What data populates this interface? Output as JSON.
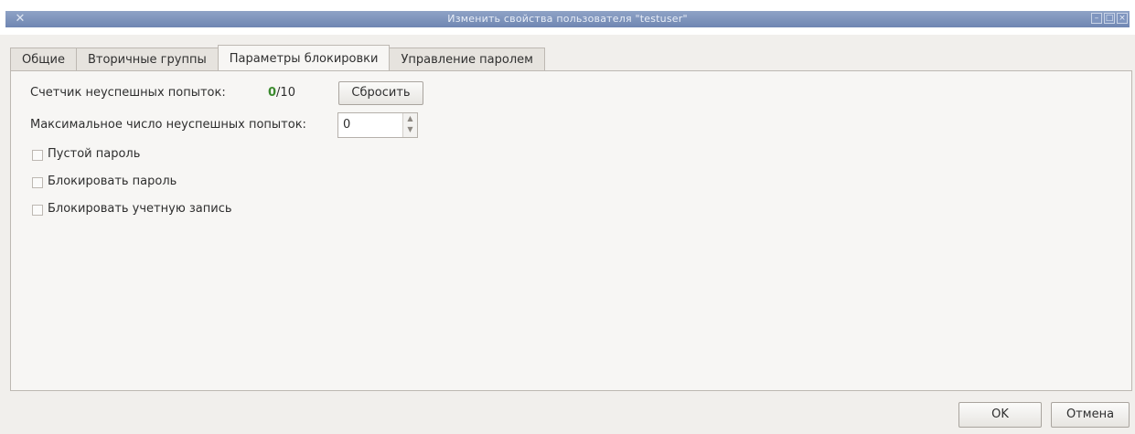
{
  "window": {
    "title": "Изменить свойства пользователя \"testuser\"",
    "app_icon": "app-icon",
    "controls": [
      "minimize-icon",
      "maximize-icon",
      "close-icon"
    ]
  },
  "tabs": [
    {
      "label": "Общие",
      "active": false
    },
    {
      "label": "Вторичные группы",
      "active": false
    },
    {
      "label": "Параметры блокировки",
      "active": true
    },
    {
      "label": "Управление паролем",
      "active": false
    }
  ],
  "lock": {
    "failed_label": "Счетчик неуспешных попыток:",
    "failed_count": "0",
    "failed_total": "/10",
    "reset_label": "Сбросить",
    "max_label": "Максимальное число неуспешных попыток:",
    "max_value": "0",
    "checkboxes": [
      {
        "label": "Пустой пароль",
        "checked": false
      },
      {
        "label": "Блокировать пароль",
        "checked": false
      },
      {
        "label": "Блокировать учетную запись",
        "checked": false
      }
    ]
  },
  "footer": {
    "ok_label": "OK",
    "cancel_label": "Отмена"
  },
  "colors": {
    "counter_ok": "#3b8a2e",
    "titlebar": "#6f86b2"
  }
}
